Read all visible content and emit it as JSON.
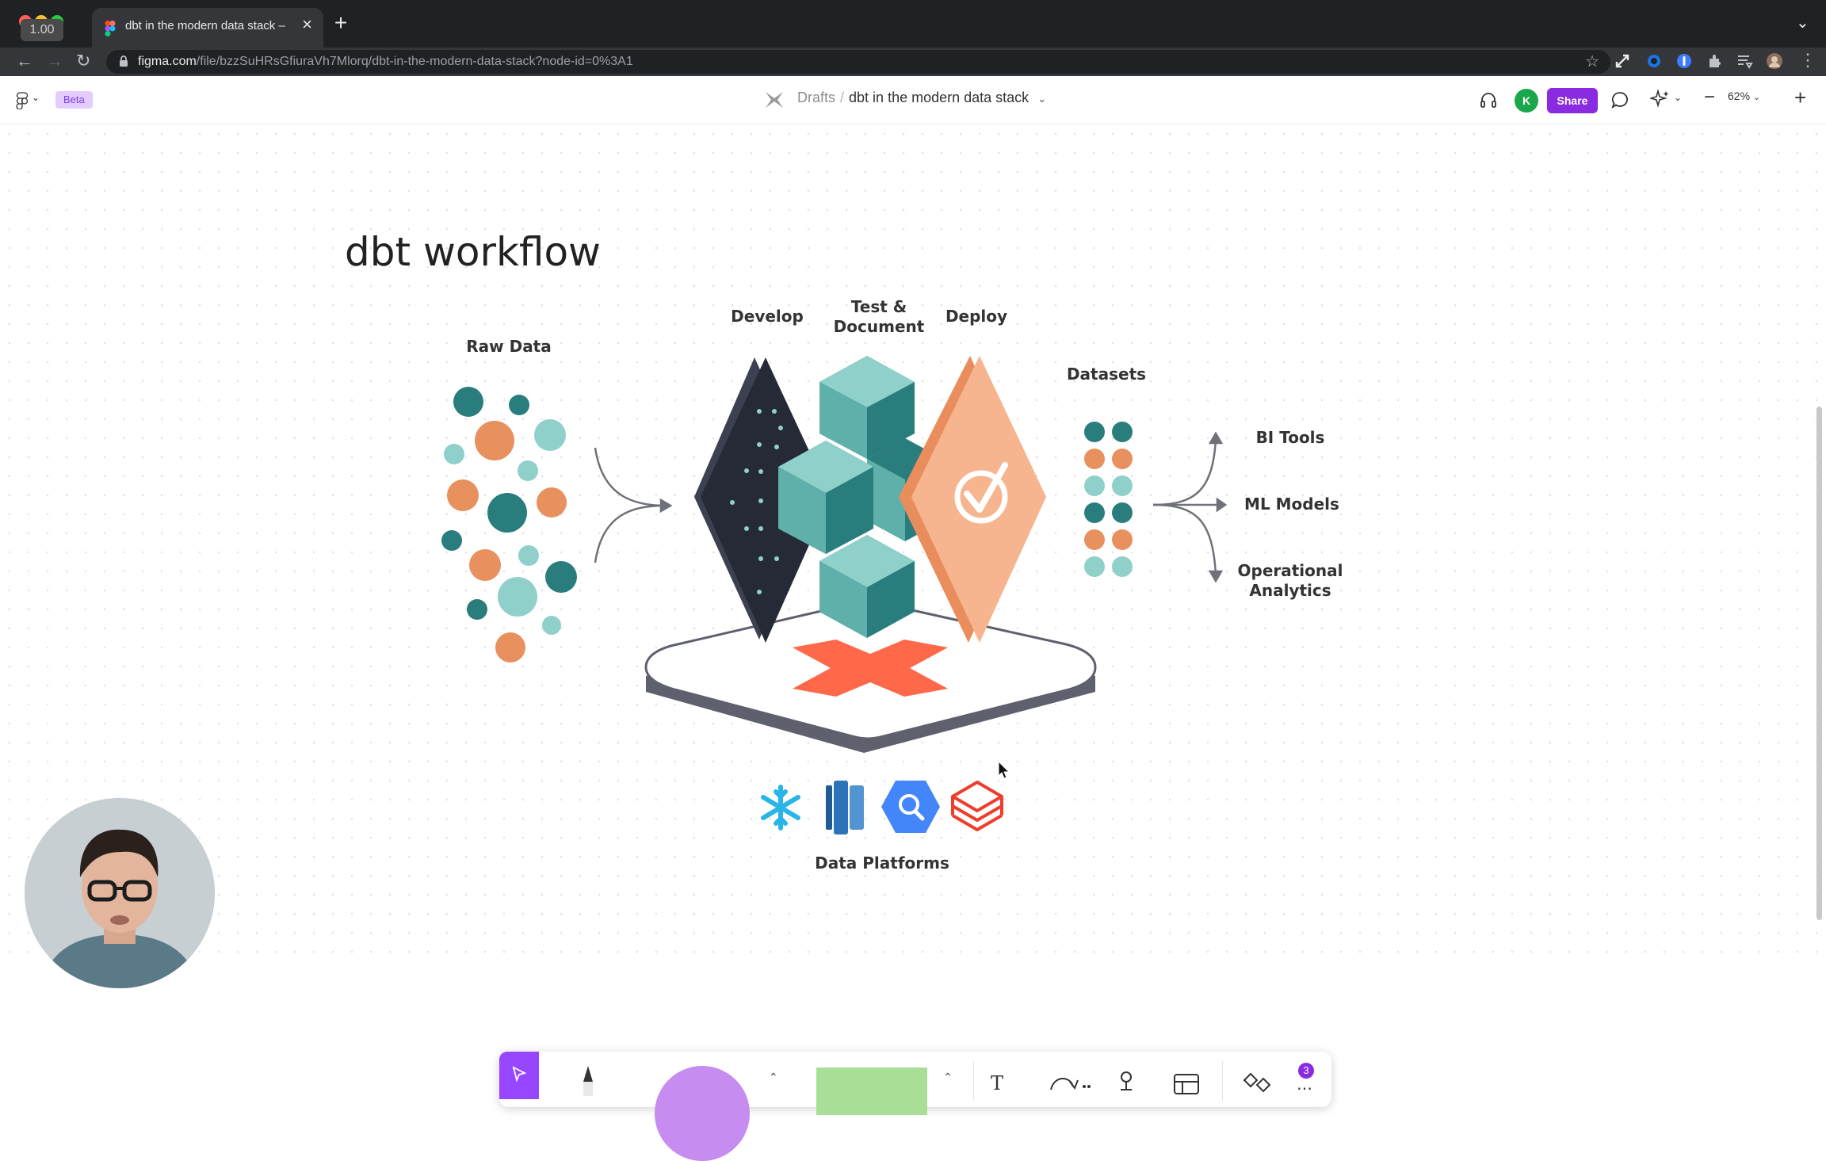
{
  "browser": {
    "tab_title": "dbt in the modern data stack –",
    "new_tab_symbol": "+",
    "version_badge": "1.00",
    "url_host": "figma.com",
    "url_path": "/file/bzzSuHRsGfiuraVh7Mlorq/dbt-in-the-modern-data-stack?node-id=0%3A1"
  },
  "figma": {
    "beta_label": "Beta",
    "breadcrumb_drafts": "Drafts",
    "breadcrumb_file": "dbt in the modern data stack",
    "avatar_initial": "K",
    "share_label": "Share",
    "zoom_level": "62%"
  },
  "board": {
    "title": "dbt workflow",
    "raw_data": "Raw Data",
    "develop": "Develop",
    "test_document": "Test &\nDocument",
    "deploy": "Deploy",
    "datasets": "Datasets",
    "bi_tools": "BI Tools",
    "ml_models": "ML Models",
    "operational_analytics": "Operational\nAnalytics",
    "data_platforms": "Data Platforms"
  },
  "toolbar": {
    "comment_count": "3"
  },
  "colors": {
    "teal_dark": "#2a7d7d",
    "teal_light": "#8fd0cb",
    "orange": "#e8905e",
    "navy": "#262a36",
    "peach": "#f6b58f",
    "dbt_orange": "#ff694a",
    "figma_purple": "#8a2be2"
  }
}
